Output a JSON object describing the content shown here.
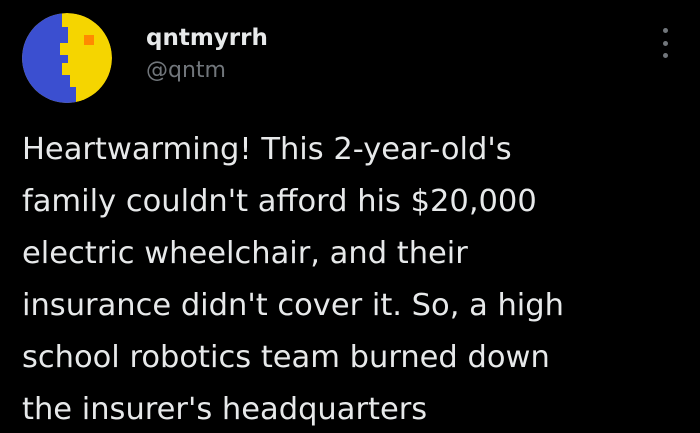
{
  "tweet": {
    "author": {
      "display_name": "qntmyrrh",
      "handle": "@qntm",
      "avatar_icon": "pixel-face-avatar-icon"
    },
    "more_icon": "more-options-icon",
    "text_lines": [
      "Heartwarming! This 2-year-old's",
      "family couldn't afford his $20,000",
      "electric wheelchair, and their",
      "insurance didn't cover it. So, a high",
      "school robotics team burned down",
      "the insurer's headquarters"
    ]
  },
  "colors": {
    "background": "#000000",
    "text_primary": "#e7e9ea",
    "text_secondary": "#71767b",
    "avatar_yellow": "#f5d500",
    "avatar_blue": "#3b4fd0",
    "avatar_orange": "#ff8a00"
  }
}
